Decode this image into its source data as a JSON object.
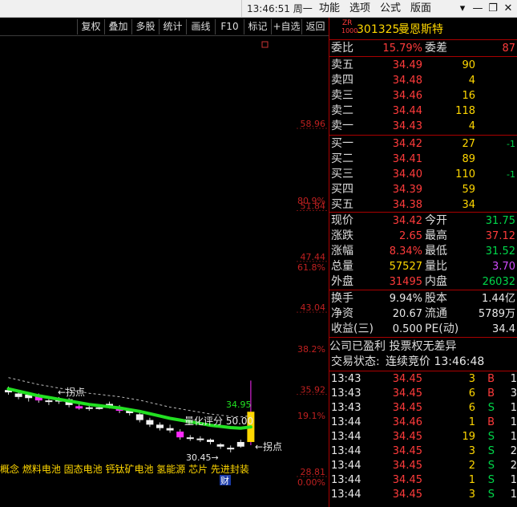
{
  "topbar": {
    "clock": "13:46:51 周一",
    "menus": [
      "功能",
      "选项",
      "公式",
      "版面"
    ],
    "window_buttons": [
      "▾",
      "—",
      "❐",
      "✕"
    ]
  },
  "toolbar": {
    "buttons": [
      "复权",
      "叠加",
      "多股",
      "统计",
      "画线",
      "F10",
      "标记",
      "+自选",
      "返回"
    ]
  },
  "chart_data": {
    "type": "candlestick",
    "price_labels": [
      "58.96",
      "51.84",
      "47.44",
      "43.04",
      "35.92",
      "28.81"
    ],
    "percent_labels": [
      "80.9%",
      "61.8%",
      "38.2%",
      "19.1%",
      "0.00%"
    ],
    "price_ylim": [
      28.81,
      58.96
    ],
    "annotations": {
      "turn_point_upper": "←拐点",
      "turn_point_lower": "←拐点",
      "quant_score": "量化评分 50.00",
      "line_value": "34.95",
      "low_price": "30.45→",
      "concepts": "概念 燃料电池 固态电池 钙钛矿电池 氢能源 芯片 先进封装",
      "finance_tag": "财"
    },
    "candles": [
      {
        "o": 36.3,
        "c": 36.1,
        "h": 36.6,
        "l": 35.9,
        "color": "white"
      },
      {
        "o": 36.0,
        "c": 35.7,
        "h": 36.3,
        "l": 35.5,
        "color": "white"
      },
      {
        "o": 35.6,
        "c": 35.9,
        "h": 36.1,
        "l": 35.3,
        "color": "white"
      },
      {
        "o": 35.9,
        "c": 35.4,
        "h": 36.0,
        "l": 35.2,
        "color": "magenta"
      },
      {
        "o": 35.4,
        "c": 35.3,
        "h": 35.6,
        "l": 35.0,
        "color": "white"
      },
      {
        "o": 35.3,
        "c": 35.5,
        "h": 35.7,
        "l": 35.1,
        "color": "white"
      },
      {
        "o": 35.5,
        "c": 35.0,
        "h": 35.6,
        "l": 34.8,
        "color": "white"
      },
      {
        "o": 34.9,
        "c": 34.7,
        "h": 35.1,
        "l": 34.6,
        "color": "magenta"
      },
      {
        "o": 34.7,
        "c": 34.8,
        "h": 35.0,
        "l": 34.5,
        "color": "white"
      },
      {
        "o": 34.8,
        "c": 34.8,
        "h": 35.0,
        "l": 34.6,
        "color": "white"
      },
      {
        "o": 34.9,
        "c": 35.1,
        "h": 35.3,
        "l": 34.7,
        "color": "white"
      },
      {
        "o": 34.8,
        "c": 34.5,
        "h": 35.0,
        "l": 34.3,
        "color": "magenta"
      },
      {
        "o": 34.6,
        "c": 34.3,
        "h": 34.7,
        "l": 34.1,
        "color": "white"
      },
      {
        "o": 34.2,
        "c": 33.7,
        "h": 34.5,
        "l": 33.5,
        "color": "white"
      },
      {
        "o": 33.7,
        "c": 33.3,
        "h": 33.9,
        "l": 33.1,
        "color": "white"
      },
      {
        "o": 33.3,
        "c": 33.0,
        "h": 33.5,
        "l": 32.8,
        "color": "white"
      },
      {
        "o": 33.0,
        "c": 32.8,
        "h": 33.3,
        "l": 32.6,
        "color": "white"
      },
      {
        "o": 32.7,
        "c": 32.2,
        "h": 32.9,
        "l": 32.0,
        "color": "magenta"
      },
      {
        "o": 32.2,
        "c": 32.1,
        "h": 32.4,
        "l": 31.9,
        "color": "white"
      },
      {
        "o": 32.1,
        "c": 32.0,
        "h": 32.3,
        "l": 31.8,
        "color": "white"
      },
      {
        "o": 32.0,
        "c": 31.8,
        "h": 32.1,
        "l": 31.6,
        "color": "white"
      },
      {
        "o": 31.6,
        "c": 31.4,
        "h": 31.7,
        "l": 31.2,
        "color": "white"
      },
      {
        "o": 31.2,
        "c": 31.3,
        "h": 31.5,
        "l": 30.9,
        "color": "white"
      },
      {
        "o": 31.4,
        "c": 31.8,
        "h": 32.0,
        "l": 31.3,
        "color": "white"
      },
      {
        "o": 31.8,
        "c": 34.42,
        "h": 37.12,
        "l": 31.52,
        "color": "yellow"
      }
    ],
    "ma": [
      36.4,
      36.2,
      36.0,
      35.8,
      35.65,
      35.5,
      35.35,
      35.2,
      35.05,
      34.95,
      34.85,
      34.75,
      34.6,
      34.45,
      34.25,
      34.05,
      33.85,
      33.7,
      33.55,
      33.4,
      33.25,
      33.15,
      33.05,
      33.0,
      33.1
    ]
  },
  "quote": {
    "code_prefix_top": "ZR",
    "code_prefix_bottom": "1000",
    "code": "301325",
    "name": "曼恩斯特",
    "ratio_label": "委比",
    "ratio_value": "15.79%",
    "diff_label": "委差",
    "diff_value": "87",
    "sells": [
      {
        "label": "卖五",
        "price": "34.49",
        "vol": "90"
      },
      {
        "label": "卖四",
        "price": "34.48",
        "vol": "4"
      },
      {
        "label": "卖三",
        "price": "34.46",
        "vol": "16"
      },
      {
        "label": "卖二",
        "price": "34.44",
        "vol": "118"
      },
      {
        "label": "卖一",
        "price": "34.43",
        "vol": "4"
      }
    ],
    "buys": [
      {
        "label": "买一",
        "price": "34.42",
        "vol": "27",
        "chg": "-1"
      },
      {
        "label": "买二",
        "price": "34.41",
        "vol": "89",
        "chg": ""
      },
      {
        "label": "买三",
        "price": "34.40",
        "vol": "110",
        "chg": "-1"
      },
      {
        "label": "买四",
        "price": "34.39",
        "vol": "59",
        "chg": ""
      },
      {
        "label": "买五",
        "price": "34.38",
        "vol": "34",
        "chg": ""
      }
    ],
    "stats": [
      {
        "l1": "现价",
        "v1": "34.42",
        "c1": "red",
        "l2": "今开",
        "v2": "31.75",
        "c2": "green"
      },
      {
        "l1": "涨跌",
        "v1": "2.65",
        "c1": "red",
        "l2": "最高",
        "v2": "37.12",
        "c2": "red"
      },
      {
        "l1": "涨幅",
        "v1": "8.34%",
        "c1": "red",
        "l2": "最低",
        "v2": "31.52",
        "c2": "green"
      },
      {
        "l1": "总量",
        "v1": "57527",
        "c1": "yellow",
        "l2": "量比",
        "v2": "3.70",
        "c2": "magenta"
      },
      {
        "l1": "外盘",
        "v1": "31495",
        "c1": "red",
        "l2": "内盘",
        "v2": "26032",
        "c2": "green"
      }
    ],
    "fund": [
      {
        "l1": "换手",
        "v1": "9.94%",
        "l2": "股本",
        "v2": "1.44亿"
      },
      {
        "l1": "净资",
        "v1": "20.67",
        "l2": "流通",
        "v2": "5789万"
      },
      {
        "l1": "收益(三)",
        "v1": "0.500",
        "l2": "PE(动)",
        "v2": "34.4"
      }
    ],
    "notice": "公司已盈利 投票权无差异",
    "status_label": "交易状态:",
    "status_value": "连续竞价 13:46:48"
  },
  "ticks": [
    {
      "time": "13:43",
      "price": "34.45",
      "vol": "3",
      "side": "B",
      "n": "1"
    },
    {
      "time": "13:43",
      "price": "34.45",
      "vol": "6",
      "side": "B",
      "n": "3"
    },
    {
      "time": "13:43",
      "price": "34.45",
      "vol": "6",
      "side": "S",
      "n": "1"
    },
    {
      "time": "13:44",
      "price": "34.46",
      "vol": "1",
      "side": "B",
      "n": "1"
    },
    {
      "time": "13:44",
      "price": "34.45",
      "vol": "19",
      "side": "S",
      "n": "1"
    },
    {
      "time": "13:44",
      "price": "34.45",
      "vol": "3",
      "side": "S",
      "n": "2"
    },
    {
      "time": "13:44",
      "price": "34.45",
      "vol": "2",
      "side": "S",
      "n": "2"
    },
    {
      "time": "13:44",
      "price": "34.45",
      "vol": "1",
      "side": "S",
      "n": "1"
    },
    {
      "time": "13:44",
      "price": "34.45",
      "vol": "3",
      "side": "S",
      "n": "1"
    }
  ],
  "colors": {
    "red": "#ff3b3b",
    "green": "#00d84a",
    "yellow": "#ffd700",
    "magenta": "#ff29ff",
    "ma_line": "#22e022",
    "separator": "#aa0000"
  }
}
